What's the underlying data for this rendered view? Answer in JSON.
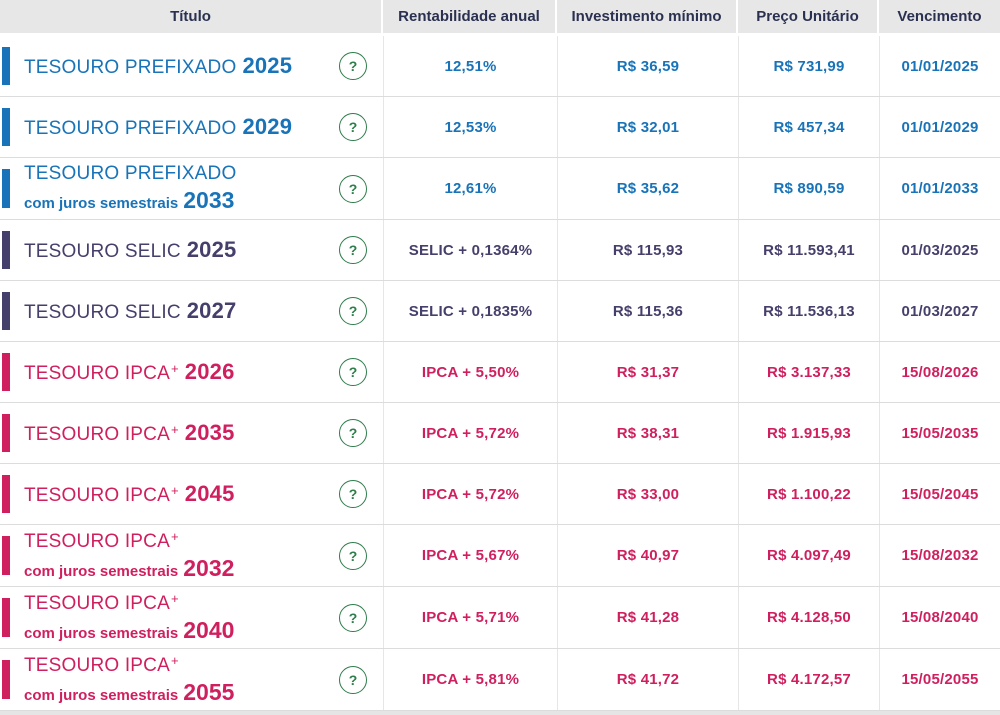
{
  "header": {
    "columns": [
      "Título",
      "Rentabilidade anual",
      "Investimento mínimo",
      "Preço Unitário",
      "Vencimento"
    ]
  },
  "colors": {
    "prefixado": "#1873b8",
    "selic": "#453f6b",
    "ipca": "#cf1f5e",
    "help_green": "#2e7d4b",
    "header_bg": "#e8e7e8",
    "header_text": "#2a3150"
  },
  "help_icon": {
    "glyph": "?"
  },
  "rows": [
    {
      "group": "prefixado",
      "name": "TESOURO PREFIXADO",
      "sup": "",
      "subtitle": "",
      "year": "2025",
      "rate": "12,51%",
      "min": "R$ 36,59",
      "price": "R$ 731,99",
      "maturity": "01/01/2025"
    },
    {
      "group": "prefixado",
      "name": "TESOURO PREFIXADO",
      "sup": "",
      "subtitle": "",
      "year": "2029",
      "rate": "12,53%",
      "min": "R$ 32,01",
      "price": "R$ 457,34",
      "maturity": "01/01/2029"
    },
    {
      "group": "prefixado",
      "name": "TESOURO PREFIXADO",
      "sup": "",
      "subtitle": "com juros semestrais",
      "year": "2033",
      "rate": "12,61%",
      "min": "R$ 35,62",
      "price": "R$ 890,59",
      "maturity": "01/01/2033"
    },
    {
      "group": "selic",
      "name": "TESOURO SELIC",
      "sup": "",
      "subtitle": "",
      "year": "2025",
      "rate": "SELIC + 0,1364%",
      "min": "R$ 115,93",
      "price": "R$ 11.593,41",
      "maturity": "01/03/2025"
    },
    {
      "group": "selic",
      "name": "TESOURO SELIC",
      "sup": "",
      "subtitle": "",
      "year": "2027",
      "rate": "SELIC + 0,1835%",
      "min": "R$ 115,36",
      "price": "R$ 11.536,13",
      "maturity": "01/03/2027"
    },
    {
      "group": "ipca",
      "name": "TESOURO IPCA",
      "sup": "+",
      "subtitle": "",
      "year": "2026",
      "rate": "IPCA + 5,50%",
      "min": "R$ 31,37",
      "price": "R$ 3.137,33",
      "maturity": "15/08/2026"
    },
    {
      "group": "ipca",
      "name": "TESOURO IPCA",
      "sup": "+",
      "subtitle": "",
      "year": "2035",
      "rate": "IPCA + 5,72%",
      "min": "R$ 38,31",
      "price": "R$ 1.915,93",
      "maturity": "15/05/2035"
    },
    {
      "group": "ipca",
      "name": "TESOURO IPCA",
      "sup": "+",
      "subtitle": "",
      "year": "2045",
      "rate": "IPCA + 5,72%",
      "min": "R$ 33,00",
      "price": "R$ 1.100,22",
      "maturity": "15/05/2045"
    },
    {
      "group": "ipca",
      "name": "TESOURO IPCA",
      "sup": "+",
      "subtitle": "com juros semestrais",
      "year": "2032",
      "rate": "IPCA + 5,67%",
      "min": "R$ 40,97",
      "price": "R$ 4.097,49",
      "maturity": "15/08/2032"
    },
    {
      "group": "ipca",
      "name": "TESOURO IPCA",
      "sup": "+",
      "subtitle": "com juros semestrais",
      "year": "2040",
      "rate": "IPCA + 5,71%",
      "min": "R$ 41,28",
      "price": "R$ 4.128,50",
      "maturity": "15/08/2040"
    },
    {
      "group": "ipca",
      "name": "TESOURO IPCA",
      "sup": "+",
      "subtitle": "com juros semestrais",
      "year": "2055",
      "rate": "IPCA + 5,81%",
      "min": "R$ 41,72",
      "price": "R$ 4.172,57",
      "maturity": "15/05/2055"
    }
  ]
}
